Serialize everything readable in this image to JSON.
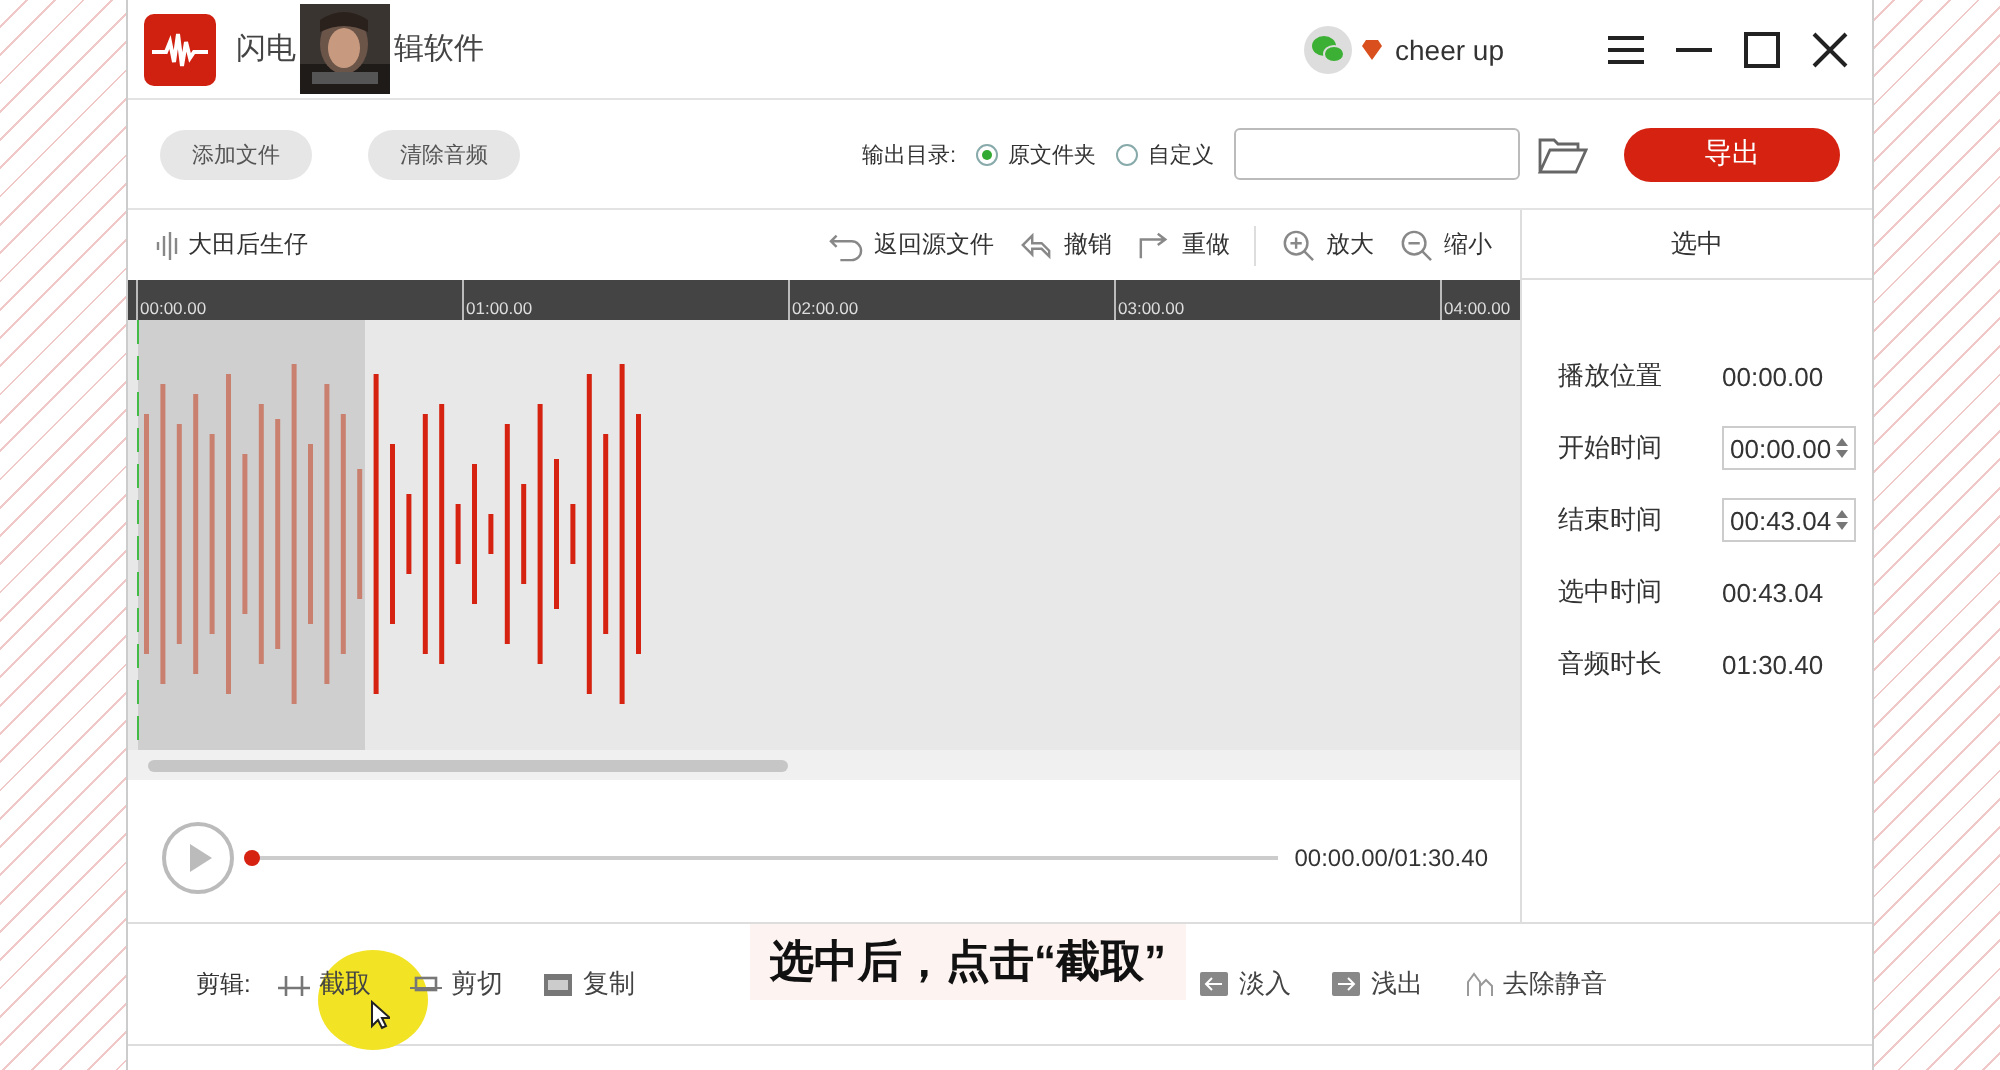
{
  "window": {
    "title_parts": [
      "闪电",
      "辑软件"
    ],
    "user": {
      "name": "cheer up"
    }
  },
  "toolbar": {
    "buttons": [
      "添加文件",
      "清除音频"
    ],
    "output_label": "输出目录:",
    "radios": [
      {
        "label": "原文件夹",
        "selected": true
      },
      {
        "label": "自定义",
        "selected": false
      }
    ],
    "export": "导出"
  },
  "editor": {
    "file_name": "大田后生仔",
    "actions": [
      {
        "kind": "undo-source",
        "label": "返回源文件"
      },
      {
        "kind": "undo",
        "label": "撤销"
      },
      {
        "kind": "redo",
        "label": "重做"
      },
      {
        "kind": "zoom-in",
        "label": "放大"
      },
      {
        "kind": "zoom-out",
        "label": "缩小"
      }
    ],
    "ruler": [
      "00:00.00",
      "01:00.00",
      "02:00.00",
      "03:00.00",
      "04:00.00"
    ],
    "selection": {
      "level": 0.17
    }
  },
  "player": {
    "progress": {
      "level": 0
    },
    "time": "00:00.00/01:30.40"
  },
  "edit_bar": {
    "label": "剪辑:",
    "tools": [
      {
        "kind": "trim",
        "label": "截取"
      },
      {
        "kind": "cut",
        "label": "剪切"
      },
      {
        "kind": "copy",
        "label": "复制"
      },
      {
        "kind": "fade-in",
        "label": "淡入"
      },
      {
        "kind": "fade-out",
        "label": "浅出"
      },
      {
        "kind": "silence",
        "label": "去除静音"
      }
    ]
  },
  "side_panel": {
    "title": "选中",
    "rows": [
      {
        "kind": "text",
        "label": "播放位置",
        "value": "00:00.00"
      },
      {
        "kind": "spinner",
        "label": "开始时间",
        "value": "00:00.00"
      },
      {
        "kind": "spinner",
        "label": "结束时间",
        "value": "00:43.04"
      },
      {
        "kind": "text",
        "label": "选中时间",
        "value": "00:43.04"
      },
      {
        "kind": "text",
        "label": "音频时长",
        "value": "01:30.40"
      }
    ]
  },
  "caption": "选中后，点击“截取”"
}
